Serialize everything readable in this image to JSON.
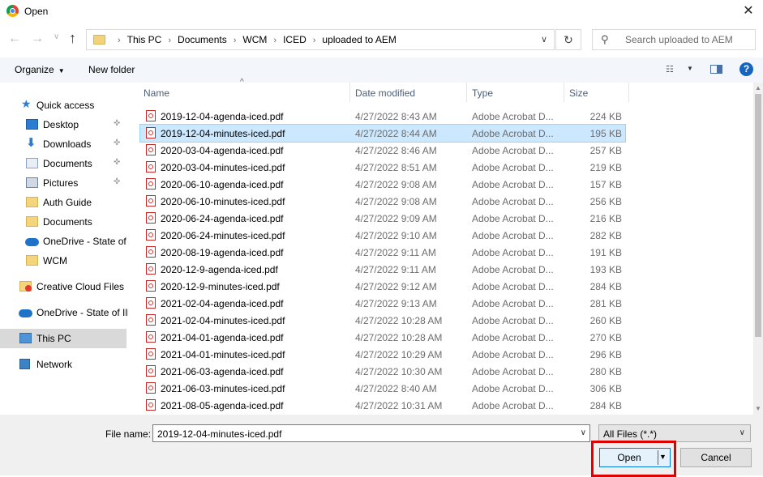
{
  "window": {
    "title": "Open",
    "close_glyph": "✕"
  },
  "nav_buttons": {
    "back": "←",
    "forward": "→",
    "recent": "∨",
    "up": "↑"
  },
  "address": {
    "breadcrumbs": [
      "This PC",
      "Documents",
      "WCM",
      "ICED",
      "uploaded to AEM"
    ],
    "separator": "›",
    "dropdown_glyph": "∨"
  },
  "refresh_glyph": "↻",
  "search": {
    "placeholder": "Search uploaded to AEM",
    "icon_glyph": "⚲"
  },
  "toolbar": {
    "organize_label": "Organize",
    "organize_arrow": "▼",
    "new_folder_label": "New folder",
    "view_glyph": "☷",
    "view_arrow": "▼",
    "help_glyph": "?"
  },
  "sidebar": {
    "pin_glyph": "✜",
    "items": [
      {
        "label": "Quick access",
        "icon": "star-icon",
        "glyph": "★",
        "pinned": false
      },
      {
        "label": "Desktop",
        "icon": "desktop-icon",
        "pinned": true
      },
      {
        "label": "Downloads",
        "icon": "download-icon",
        "glyph": "⬇",
        "pinned": true
      },
      {
        "label": "Documents",
        "icon": "documents-icon",
        "pinned": true
      },
      {
        "label": "Pictures",
        "icon": "pictures-icon",
        "pinned": true
      },
      {
        "label": "Auth Guide",
        "icon": "folder-icon",
        "pinned": false
      },
      {
        "label": "Documents",
        "icon": "folder-icon",
        "pinned": false
      },
      {
        "label": "OneDrive - State of",
        "icon": "cloud-icon",
        "pinned": false
      },
      {
        "label": "WCM",
        "icon": "folder-icon",
        "pinned": false
      },
      {
        "label": "Creative Cloud Files",
        "icon": "creative-cloud-icon",
        "pinned": false
      },
      {
        "label": "OneDrive - State of Ill",
        "icon": "cloud-icon",
        "pinned": false
      },
      {
        "label": "This PC",
        "icon": "computer-icon",
        "pinned": false,
        "selected": true
      },
      {
        "label": "Network",
        "icon": "network-icon",
        "pinned": false
      }
    ]
  },
  "columns": {
    "name": "Name",
    "date": "Date modified",
    "type": "Type",
    "size": "Size",
    "sort_glyph": "^"
  },
  "files": [
    {
      "name": "2019-12-04-agenda-iced.pdf",
      "date": "4/27/2022 8:43 AM",
      "type": "Adobe Acrobat D...",
      "size": "224 KB"
    },
    {
      "name": "2019-12-04-minutes-iced.pdf",
      "date": "4/27/2022 8:44 AM",
      "type": "Adobe Acrobat D...",
      "size": "195 KB",
      "selected": true
    },
    {
      "name": "2020-03-04-agenda-iced.pdf",
      "date": "4/27/2022 8:46 AM",
      "type": "Adobe Acrobat D...",
      "size": "257 KB"
    },
    {
      "name": "2020-03-04-minutes-iced.pdf",
      "date": "4/27/2022 8:51 AM",
      "type": "Adobe Acrobat D...",
      "size": "219 KB"
    },
    {
      "name": "2020-06-10-agenda-iced.pdf",
      "date": "4/27/2022 9:08 AM",
      "type": "Adobe Acrobat D...",
      "size": "157 KB"
    },
    {
      "name": "2020-06-10-minutes-iced.pdf",
      "date": "4/27/2022 9:08 AM",
      "type": "Adobe Acrobat D...",
      "size": "256 KB"
    },
    {
      "name": "2020-06-24-agenda-iced.pdf",
      "date": "4/27/2022 9:09 AM",
      "type": "Adobe Acrobat D...",
      "size": "216 KB"
    },
    {
      "name": "2020-06-24-minutes-iced.pdf",
      "date": "4/27/2022 9:10 AM",
      "type": "Adobe Acrobat D...",
      "size": "282 KB"
    },
    {
      "name": "2020-08-19-agenda-iced.pdf",
      "date": "4/27/2022 9:11 AM",
      "type": "Adobe Acrobat D...",
      "size": "191 KB"
    },
    {
      "name": "2020-12-9-agenda-iced.pdf",
      "date": "4/27/2022 9:11 AM",
      "type": "Adobe Acrobat D...",
      "size": "193 KB"
    },
    {
      "name": "2020-12-9-minutes-iced.pdf",
      "date": "4/27/2022 9:12 AM",
      "type": "Adobe Acrobat D...",
      "size": "284 KB"
    },
    {
      "name": "2021-02-04-agenda-iced.pdf",
      "date": "4/27/2022 9:13 AM",
      "type": "Adobe Acrobat D...",
      "size": "281 KB"
    },
    {
      "name": "2021-02-04-minutes-iced.pdf",
      "date": "4/27/2022 10:28 AM",
      "type": "Adobe Acrobat D...",
      "size": "260 KB"
    },
    {
      "name": "2021-04-01-agenda-iced.pdf",
      "date": "4/27/2022 10:28 AM",
      "type": "Adobe Acrobat D...",
      "size": "270 KB"
    },
    {
      "name": "2021-04-01-minutes-iced.pdf",
      "date": "4/27/2022 10:29 AM",
      "type": "Adobe Acrobat D...",
      "size": "296 KB"
    },
    {
      "name": "2021-06-03-agenda-iced.pdf",
      "date": "4/27/2022 10:30 AM",
      "type": "Adobe Acrobat D...",
      "size": "280 KB"
    },
    {
      "name": "2021-06-03-minutes-iced.pdf",
      "date": "4/27/2022 8:40 AM",
      "type": "Adobe Acrobat D...",
      "size": "306 KB"
    },
    {
      "name": "2021-08-05-agenda-iced.pdf",
      "date": "4/27/2022 10:31 AM",
      "type": "Adobe Acrobat D...",
      "size": "284 KB"
    }
  ],
  "footer": {
    "file_name_label": "File name:",
    "file_name_value": "2019-12-04-minutes-iced.pdf",
    "filter_value": "All Files (*.*)",
    "dropdown_glyph": "∨",
    "open_label": "Open",
    "open_arrow": "▼",
    "cancel_label": "Cancel"
  },
  "scroll_glyphs": {
    "up": "▲",
    "down": "▼"
  },
  "colors": {
    "selection": "#cce8ff",
    "accent": "#0078d7",
    "highlight": "#e00000",
    "toolbar_bg": "#f3f6fb"
  }
}
